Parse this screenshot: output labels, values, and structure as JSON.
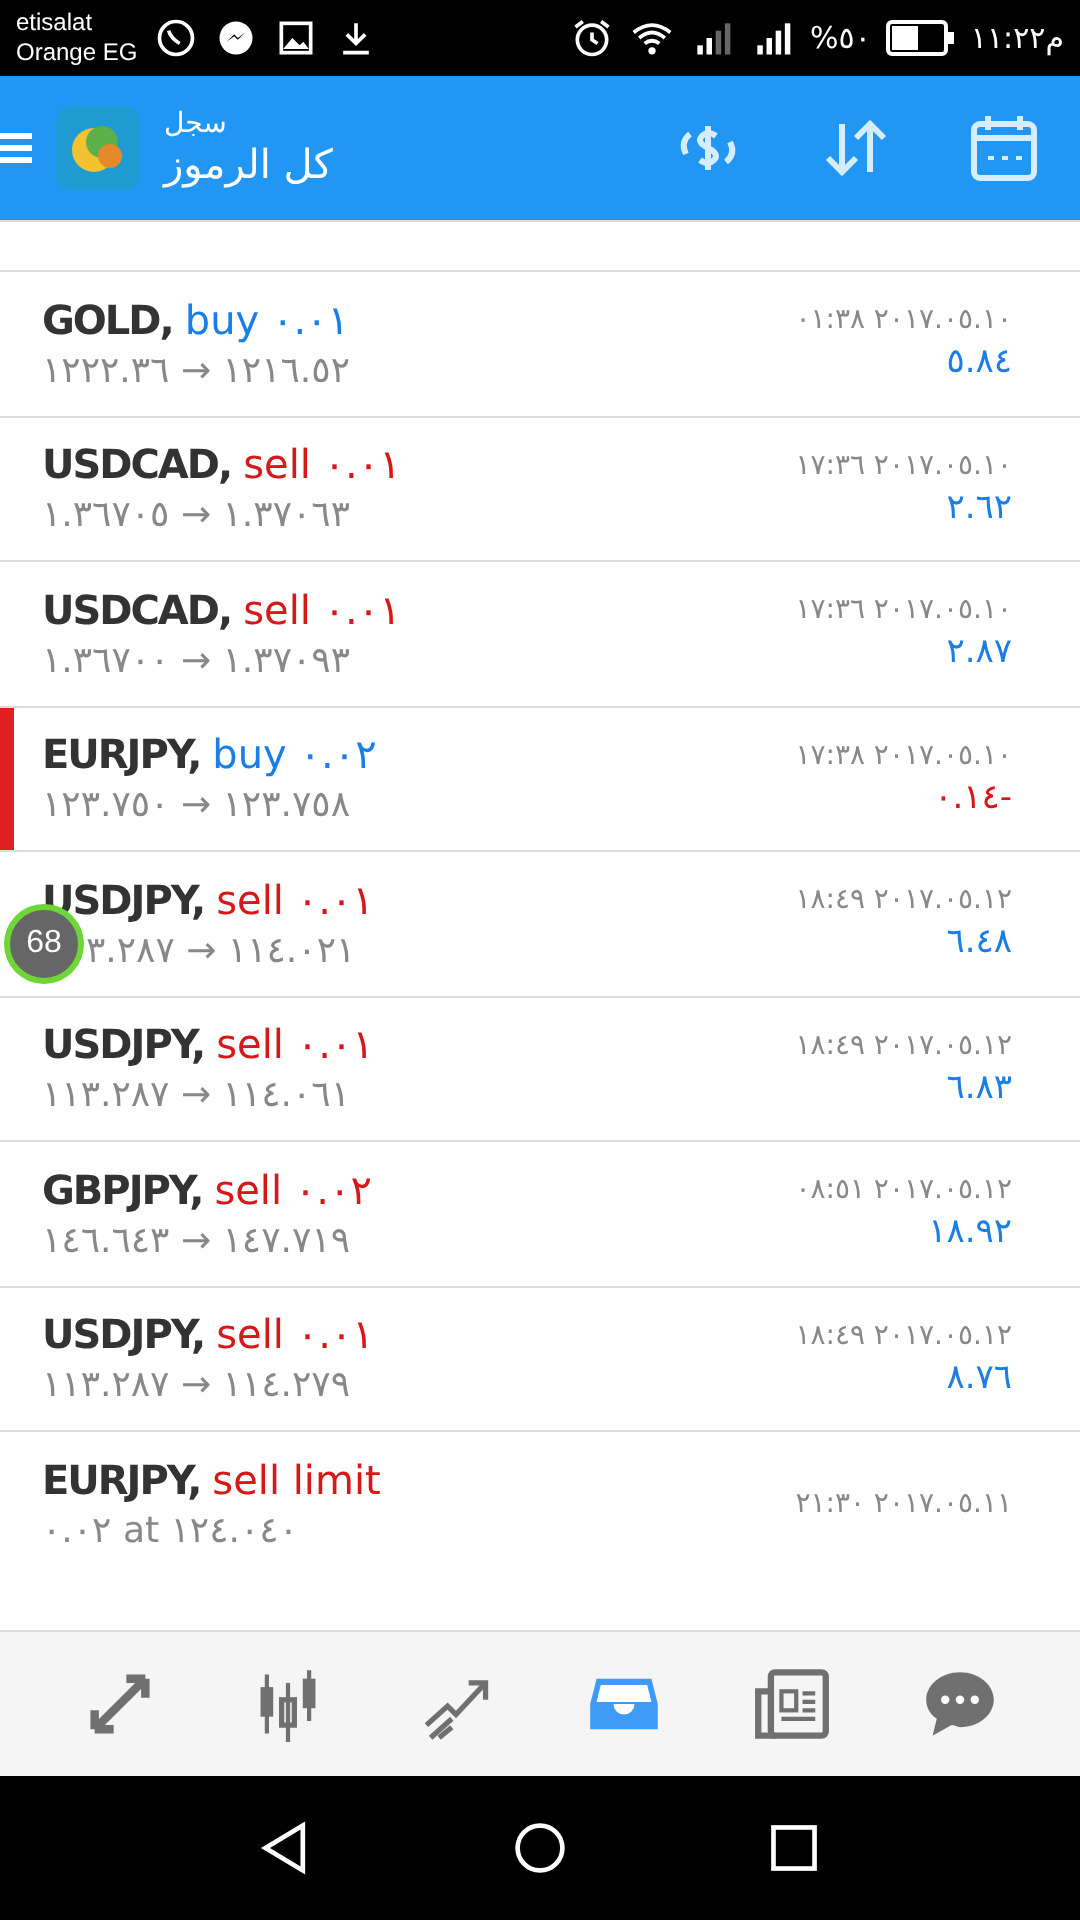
{
  "status_bar": {
    "carrier_1": "etisalat",
    "carrier_2": "Orange EG",
    "battery_text": "%٥٠",
    "time": "١١:٢٢م"
  },
  "header": {
    "subtitle": "سجل",
    "title": "كل الرموز"
  },
  "trades": [
    {
      "kind": "deal",
      "symbol": "GOLD,",
      "action": {
        "text": "buy ٠.٠١",
        "kind": "buy"
      },
      "time": "٠١:٣٨ ٢٠١٧.٠٥.١٠",
      "prices": "١٢٢٢.٣٦ → ١٢١٦.٥٢",
      "profit": {
        "text": "٥.٨٤",
        "kind": "gain"
      },
      "highlighted": false
    },
    {
      "kind": "deal",
      "symbol": "USDCAD,",
      "action": {
        "text": "sell ٠.٠١",
        "kind": "sell"
      },
      "time": "١٧:٣٦ ٢٠١٧.٠٥.١٠",
      "prices": "١.٣٦٧٠٥ → ١.٣٧٠٦٣",
      "profit": {
        "text": "٢.٦٢",
        "kind": "gain"
      },
      "highlighted": false
    },
    {
      "kind": "deal",
      "symbol": "USDCAD,",
      "action": {
        "text": "sell ٠.٠١",
        "kind": "sell"
      },
      "time": "١٧:٣٦ ٢٠١٧.٠٥.١٠",
      "prices": "١.٣٦٧٠٠ → ١.٣٧٠٩٣",
      "profit": {
        "text": "٢.٨٧",
        "kind": "gain"
      },
      "highlighted": false
    },
    {
      "kind": "deal",
      "symbol": "EURJPY,",
      "action": {
        "text": "buy ٠.٠٢",
        "kind": "buy"
      },
      "time": "١٧:٣٨ ٢٠١٧.٠٥.١٠",
      "prices": "١٢٣.٧٥٠ → ١٢٣.٧٥٨",
      "profit": {
        "text": "٠.١٤-",
        "kind": "loss"
      },
      "highlighted": true
    },
    {
      "kind": "deal",
      "symbol": "USDJPY,",
      "action": {
        "text": "sell ٠.٠١",
        "kind": "sell"
      },
      "time": "١٨:٤٩ ٢٠١٧.٠٥.١٢",
      "prices": "٣.٢٨٧ → ١١٤.٠٢١",
      "profit": {
        "text": "٦.٤٨",
        "kind": "gain"
      },
      "highlighted": false,
      "overlay_badge": "68"
    },
    {
      "kind": "deal",
      "symbol": "USDJPY,",
      "action": {
        "text": "sell ٠.٠١",
        "kind": "sell"
      },
      "time": "١٨:٤٩ ٢٠١٧.٠٥.١٢",
      "prices": "١١٣.٢٨٧ → ١١٤.٠٦١",
      "profit": {
        "text": "٦.٨٣",
        "kind": "gain"
      },
      "highlighted": false
    },
    {
      "kind": "deal",
      "symbol": "GBPJPY,",
      "action": {
        "text": "sell ٠.٠٢",
        "kind": "sell"
      },
      "time": "٠٨:٥١ ٢٠١٧.٠٥.١٢",
      "prices": "١٤٦.٦٤٣ → ١٤٧.٧١٩",
      "profit": {
        "text": "١٨.٩٢",
        "kind": "gain"
      },
      "highlighted": false
    },
    {
      "kind": "deal",
      "symbol": "USDJPY,",
      "action": {
        "text": "sell ٠.٠١",
        "kind": "sell"
      },
      "time": "١٨:٤٩ ٢٠١٧.٠٥.١٢",
      "prices": "١١٣.٢٨٧ → ١١٤.٢٧٩",
      "profit": {
        "text": "٨.٧٦",
        "kind": "gain"
      },
      "highlighted": false
    },
    {
      "kind": "pending",
      "symbol": "EURJPY,",
      "action": {
        "text": "sell limit",
        "kind": "sell"
      },
      "time": "٢١:٣٠ ٢٠١٧.٠٥.١١",
      "prices": "٠.٠٢ at ١٢٤.٠٤٠",
      "highlighted": false
    }
  ],
  "bottom_tabs": [
    {
      "kind": "quotes",
      "selected": false
    },
    {
      "kind": "chart",
      "selected": false
    },
    {
      "kind": "trade",
      "selected": false
    },
    {
      "kind": "history",
      "selected": true
    },
    {
      "kind": "news",
      "selected": false
    },
    {
      "kind": "chat",
      "selected": false
    }
  ]
}
